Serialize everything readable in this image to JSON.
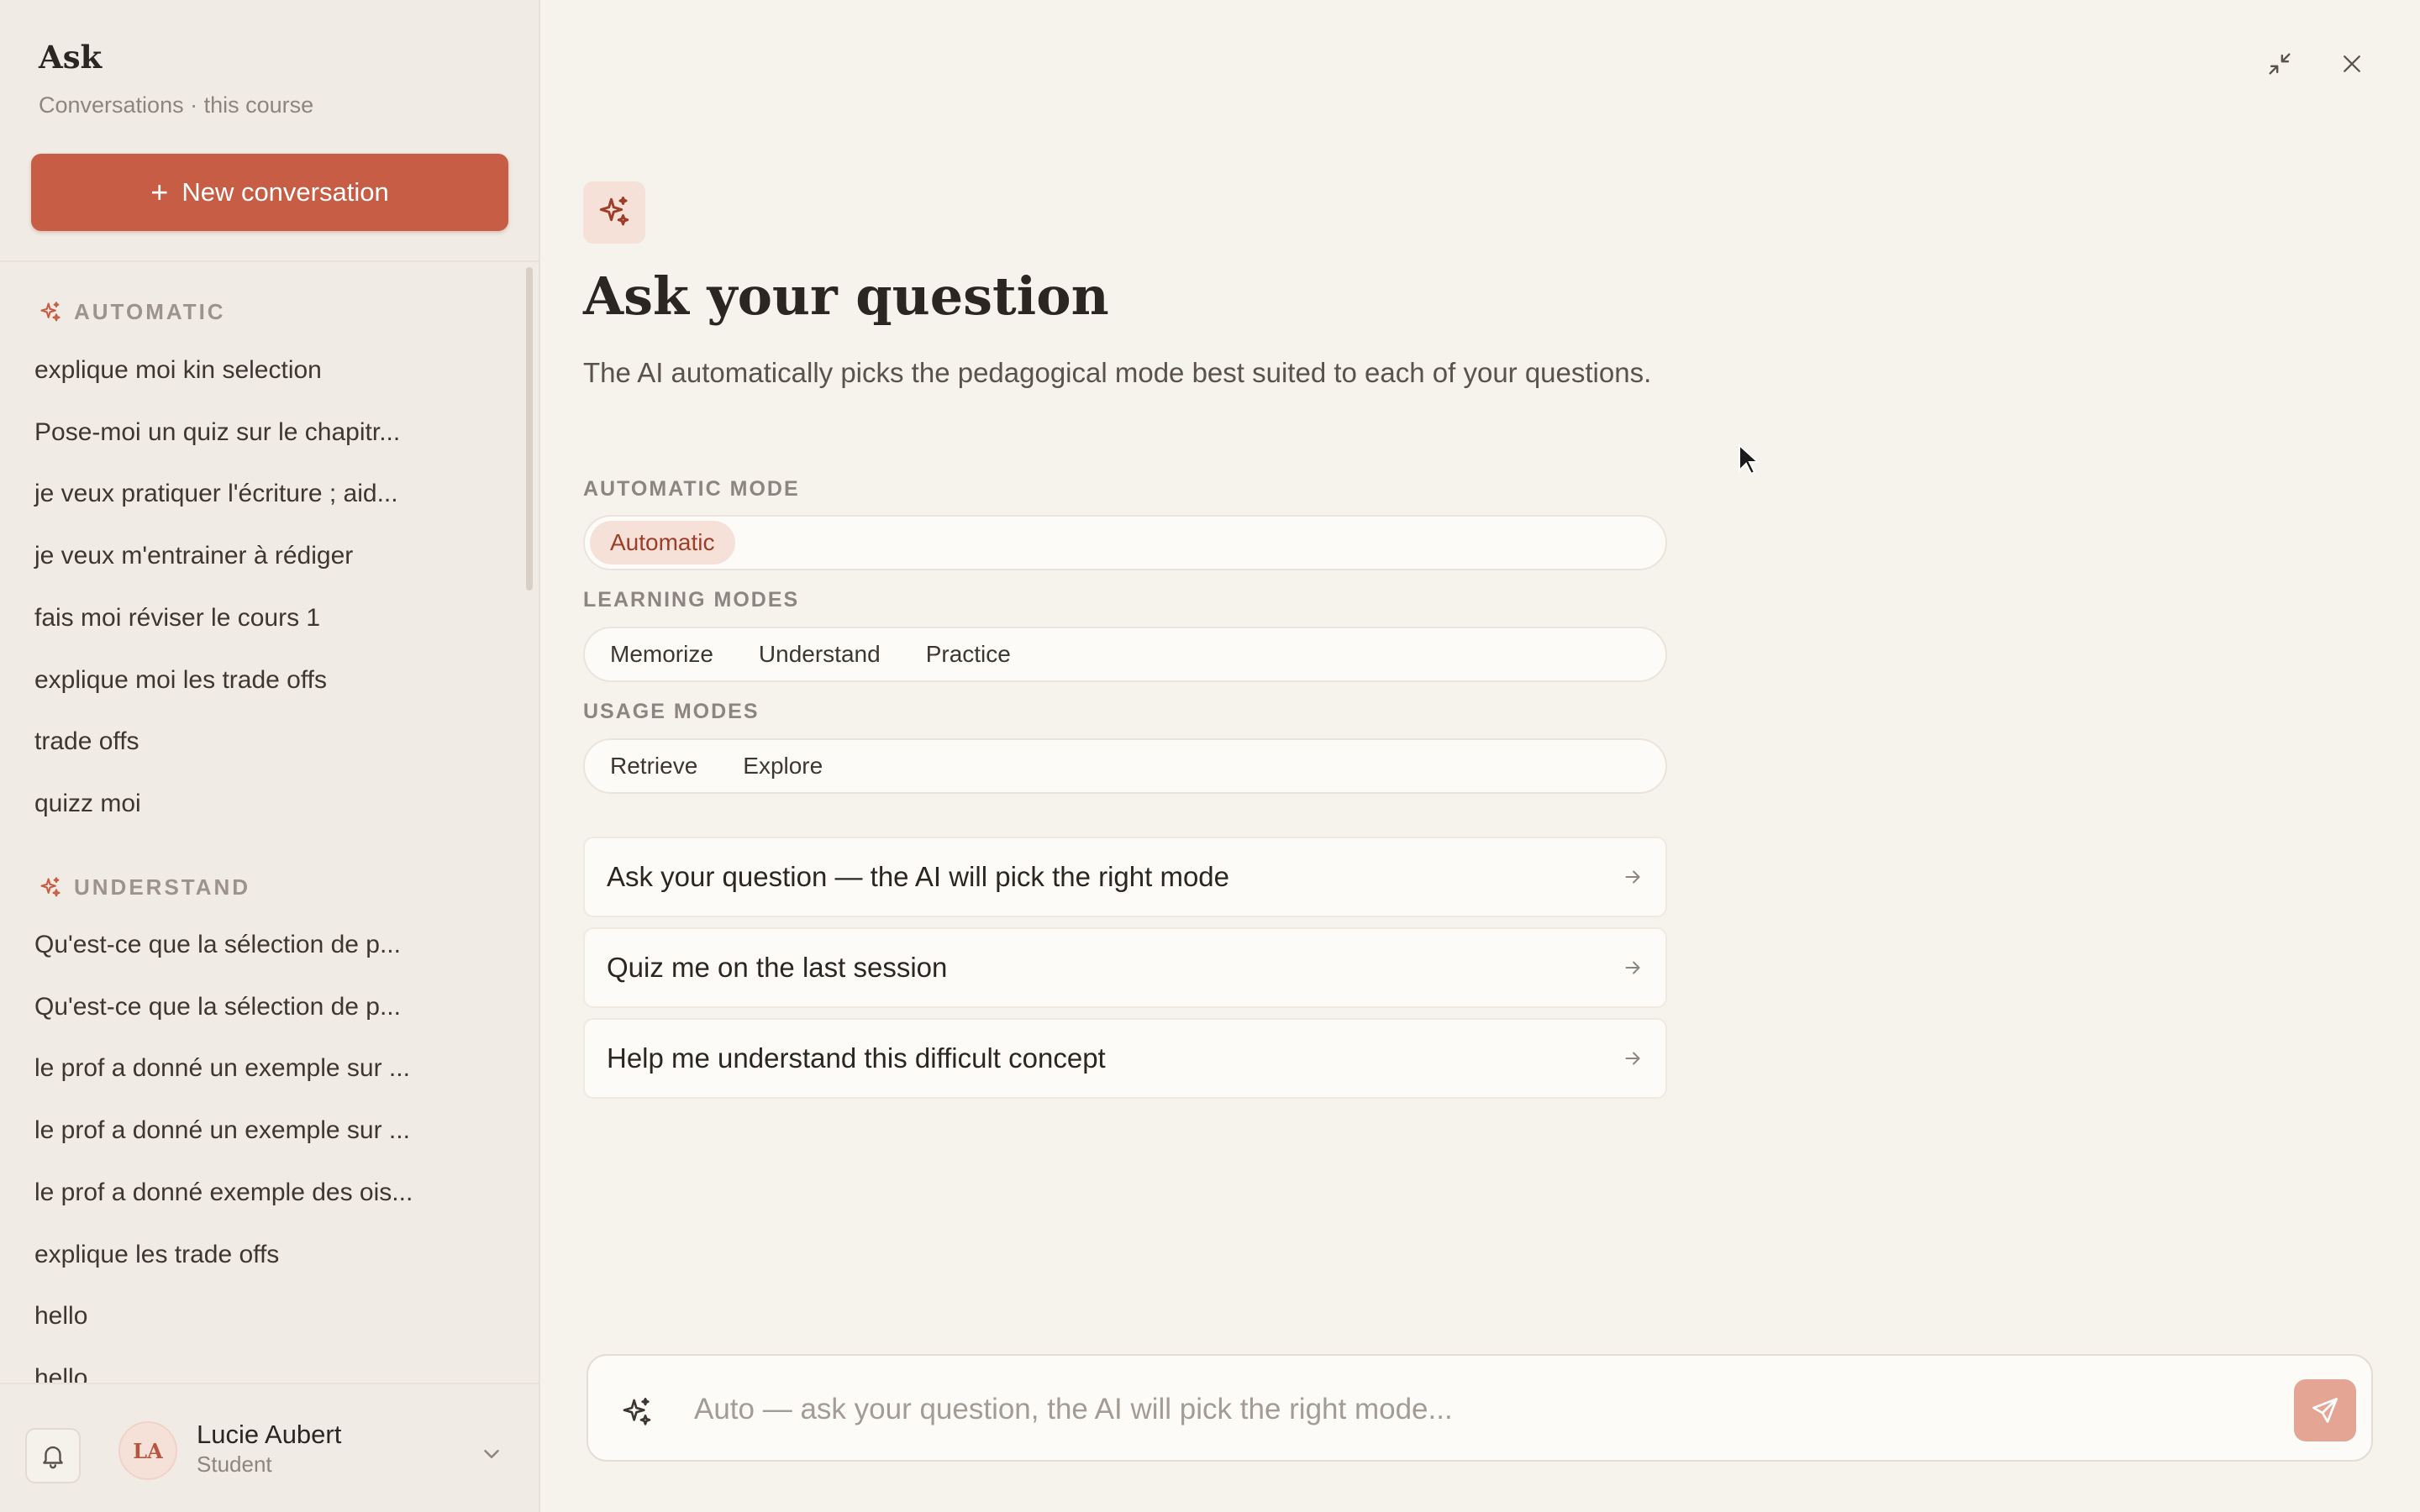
{
  "sidebar": {
    "title": "Ask",
    "subtitle": "Conversations · this course",
    "new_button_label": "New conversation",
    "sections": [
      {
        "heading": "AUTOMATIC",
        "icon": "sparkle-icon",
        "items": [
          "explique moi kin selection",
          "Pose-moi un quiz sur le chapitr...",
          "je veux pratiquer l'écriture ; aid...",
          "je veux m'entrainer à rédiger",
          "fais moi réviser le cours 1",
          "explique moi les trade offs",
          "trade offs",
          "quizz moi"
        ]
      },
      {
        "heading": "UNDERSTAND",
        "icon": "sparkle-icon",
        "items": [
          "Qu'est-ce que la sélection de p...",
          "Qu'est-ce que la sélection de p...",
          "le prof a donné un exemple sur ...",
          "le prof a donné un exemple sur ...",
          "le prof a donné exemple des ois...",
          "explique les trade offs",
          "hello",
          "hello"
        ]
      }
    ],
    "user": {
      "initials": "LA",
      "name": "Lucie Aubert",
      "role": "Student"
    }
  },
  "main": {
    "title": "Ask your question",
    "description": "The AI automatically picks the pedagogical mode best suited to each of your questions.",
    "automatic_mode": {
      "label": "AUTOMATIC MODE",
      "chips": [
        "Automatic"
      ],
      "selected": "Automatic"
    },
    "learning_modes": {
      "label": "LEARNING MODES",
      "chips": [
        "Memorize",
        "Understand",
        "Practice"
      ]
    },
    "usage_modes": {
      "label": "USAGE MODES",
      "chips": [
        "Retrieve",
        "Explore"
      ]
    },
    "suggestions": [
      "Ask your question — the AI will pick the right mode",
      "Quiz me on the last session",
      "Help me understand this difficult concept"
    ]
  },
  "composer": {
    "placeholder": "Auto — ask your question, the AI will pick the right mode..."
  },
  "colors": {
    "accent": "#c75d45",
    "accent_soft": "#f6e1d9",
    "background": "#f6f2ec",
    "sidebar_bg": "#f0ebe4"
  }
}
